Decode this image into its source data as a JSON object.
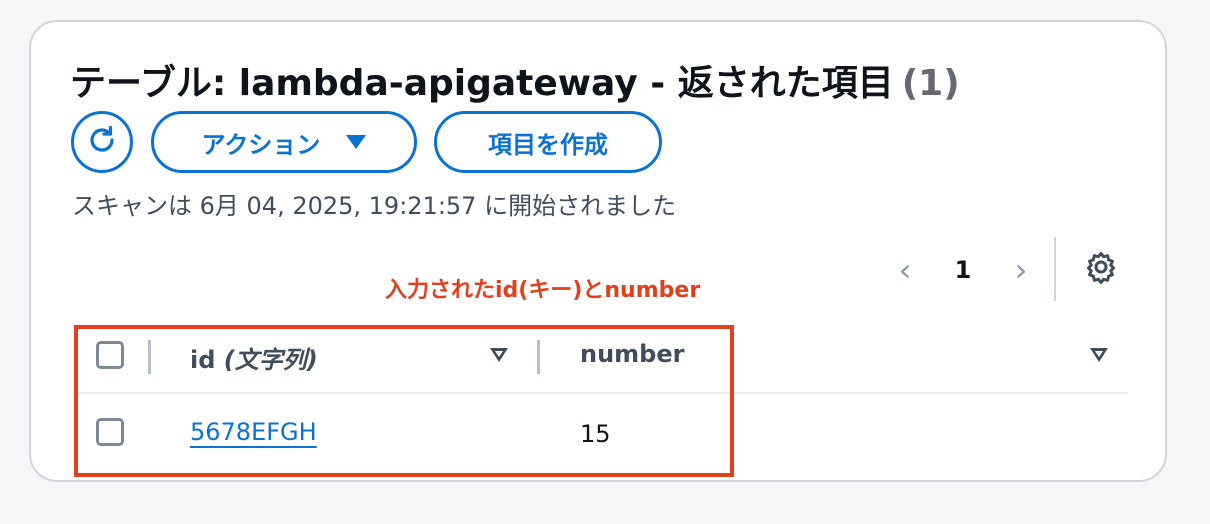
{
  "header": {
    "title": "テーブル: lambda-apigateway - 返された項目",
    "count": "(1)"
  },
  "toolbar": {
    "refresh_icon": "refresh-icon",
    "actions_label": "アクション",
    "create_label": "項目を作成"
  },
  "scan_status": "スキャンは 6月 04, 2025, 19:21:57 に開始されました",
  "pagination": {
    "prev_icon": "‹",
    "current_page": "1",
    "next_icon": "›"
  },
  "annotation": {
    "text": "入力されたid(キー)とnumber",
    "color": "#e2401c"
  },
  "table": {
    "columns": [
      {
        "label": "id",
        "type_label": "(文字列)"
      },
      {
        "label": "number"
      }
    ],
    "rows": [
      {
        "id": "5678EFGH",
        "number": "15"
      }
    ]
  },
  "colors": {
    "accent": "#0972d3",
    "annotation": "#e2401c"
  }
}
